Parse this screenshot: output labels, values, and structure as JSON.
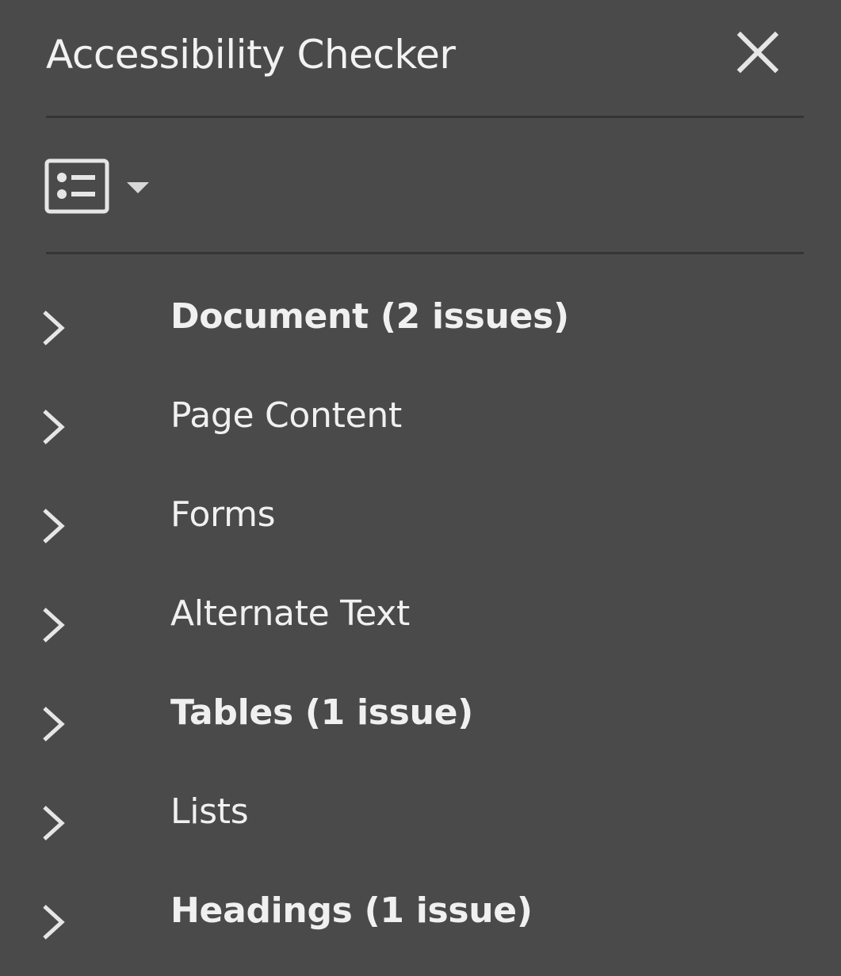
{
  "panel": {
    "title": "Accessibility Checker",
    "close_icon": "close-icon",
    "view_icon": "list-view-icon",
    "view_caret_icon": "caret-down-icon"
  },
  "colors": {
    "background": "#4a4a4a",
    "divider": "#353535",
    "text": "#f0f0f0"
  },
  "tree": {
    "items": [
      {
        "label": "Document (2 issues)",
        "bold": true,
        "icon": "chevron-right-icon"
      },
      {
        "label": "Page Content",
        "bold": false,
        "icon": "chevron-right-icon"
      },
      {
        "label": "Forms",
        "bold": false,
        "icon": "chevron-right-icon"
      },
      {
        "label": "Alternate Text",
        "bold": false,
        "icon": "chevron-right-icon"
      },
      {
        "label": "Tables (1 issue)",
        "bold": true,
        "icon": "chevron-right-icon"
      },
      {
        "label": "Lists",
        "bold": false,
        "icon": "chevron-right-icon"
      },
      {
        "label": "Headings (1 issue)",
        "bold": true,
        "icon": "chevron-right-icon"
      }
    ]
  }
}
